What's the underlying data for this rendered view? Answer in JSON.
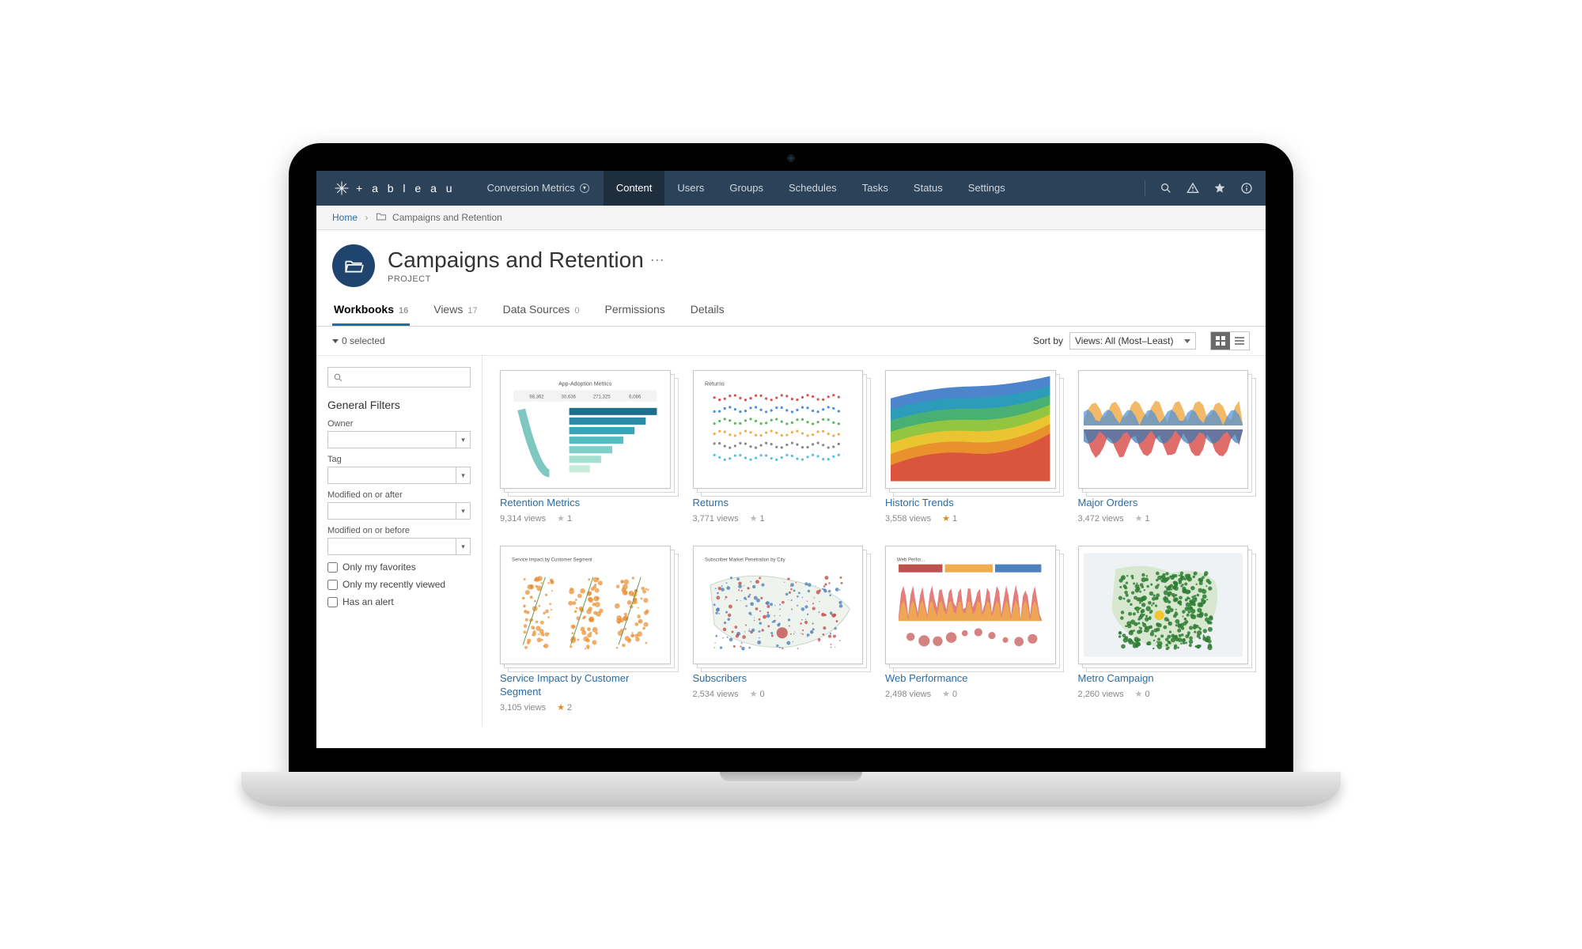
{
  "brand": "+ a b l e a u",
  "site_picker": "Conversion Metrics",
  "nav": [
    {
      "label": "Content",
      "active": true
    },
    {
      "label": "Users"
    },
    {
      "label": "Groups"
    },
    {
      "label": "Schedules"
    },
    {
      "label": "Tasks"
    },
    {
      "label": "Status"
    },
    {
      "label": "Settings"
    }
  ],
  "breadcrumb": {
    "home": "Home",
    "current": "Campaigns and Retention"
  },
  "page": {
    "title": "Campaigns and Retention",
    "subtitle": "PROJECT"
  },
  "tabs": [
    {
      "label": "Workbooks",
      "count": "16",
      "active": true
    },
    {
      "label": "Views",
      "count": "17"
    },
    {
      "label": "Data Sources",
      "count": "0"
    },
    {
      "label": "Permissions",
      "count": ""
    },
    {
      "label": "Details",
      "count": ""
    }
  ],
  "toolbar": {
    "selected": "0 selected",
    "sort_label": "Sort by",
    "sort_value": "Views: All (Most–Least)"
  },
  "filters": {
    "heading": "General Filters",
    "labels": {
      "owner": "Owner",
      "tag": "Tag",
      "mod_after": "Modified on or after",
      "mod_before": "Modified on or before"
    },
    "checks": {
      "favorites": "Only my favorites",
      "recent": "Only my recently viewed",
      "alert": "Has an alert"
    }
  },
  "cards": [
    {
      "title": "Retention Metrics",
      "views": "9,314 views",
      "stars": "1",
      "fav": false,
      "thumb_label": "App-Adoption Metrics"
    },
    {
      "title": "Returns",
      "views": "3,771 views",
      "stars": "1",
      "fav": false,
      "thumb_label": "Returns"
    },
    {
      "title": "Historic Trends",
      "views": "3,558 views",
      "stars": "1",
      "fav": true,
      "thumb_label": ""
    },
    {
      "title": "Major Orders",
      "views": "3,472 views",
      "stars": "1",
      "fav": false,
      "thumb_label": ""
    },
    {
      "title": "Service Impact by Customer Segment",
      "views": "3,105 views",
      "stars": "2",
      "fav": true,
      "thumb_label": "Service Impact by Customer Segment"
    },
    {
      "title": "Subscribers",
      "views": "2,534 views",
      "stars": "0",
      "fav": false,
      "thumb_label": "Subscriber Market Penetration by City"
    },
    {
      "title": "Web Performance",
      "views": "2,498 views",
      "stars": "0",
      "fav": false,
      "thumb_label": "Web Perfor..."
    },
    {
      "title": "Metro Campaign",
      "views": "2,260 views",
      "stars": "0",
      "fav": false,
      "thumb_label": ""
    }
  ]
}
